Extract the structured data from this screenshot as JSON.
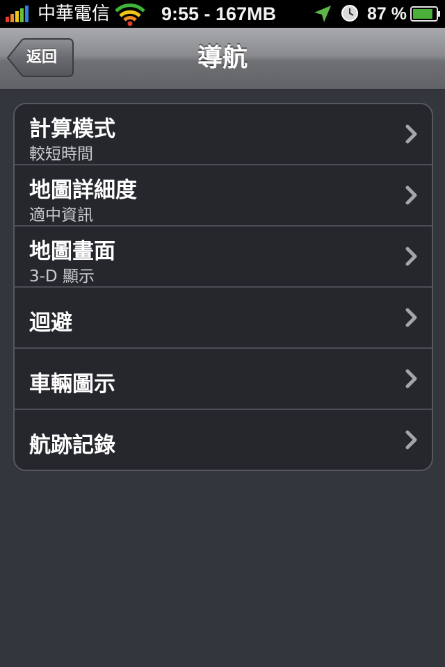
{
  "status_bar": {
    "carrier": "中華電信",
    "time": "9:55 - 167MB",
    "battery_percent": "87 %",
    "battery_level": 0.87,
    "icons": [
      "signal-bars-icon",
      "wifi-icon",
      "location-arrow-icon",
      "alarm-clock-icon",
      "battery-icon"
    ]
  },
  "nav": {
    "back_label": "返回",
    "title": "導航"
  },
  "settings": {
    "rows": [
      {
        "title": "計算模式",
        "subtitle": "較短時間"
      },
      {
        "title": "地圖詳細度",
        "subtitle": "適中資訊"
      },
      {
        "title": "地圖畫面",
        "subtitle": "3-D 顯示"
      },
      {
        "title": "迴避"
      },
      {
        "title": "車輛圖示"
      },
      {
        "title": "航跡記錄"
      }
    ]
  },
  "colors": {
    "background": "#33363c",
    "group_background": "#25272c",
    "accent_green": "#4caf3a"
  }
}
